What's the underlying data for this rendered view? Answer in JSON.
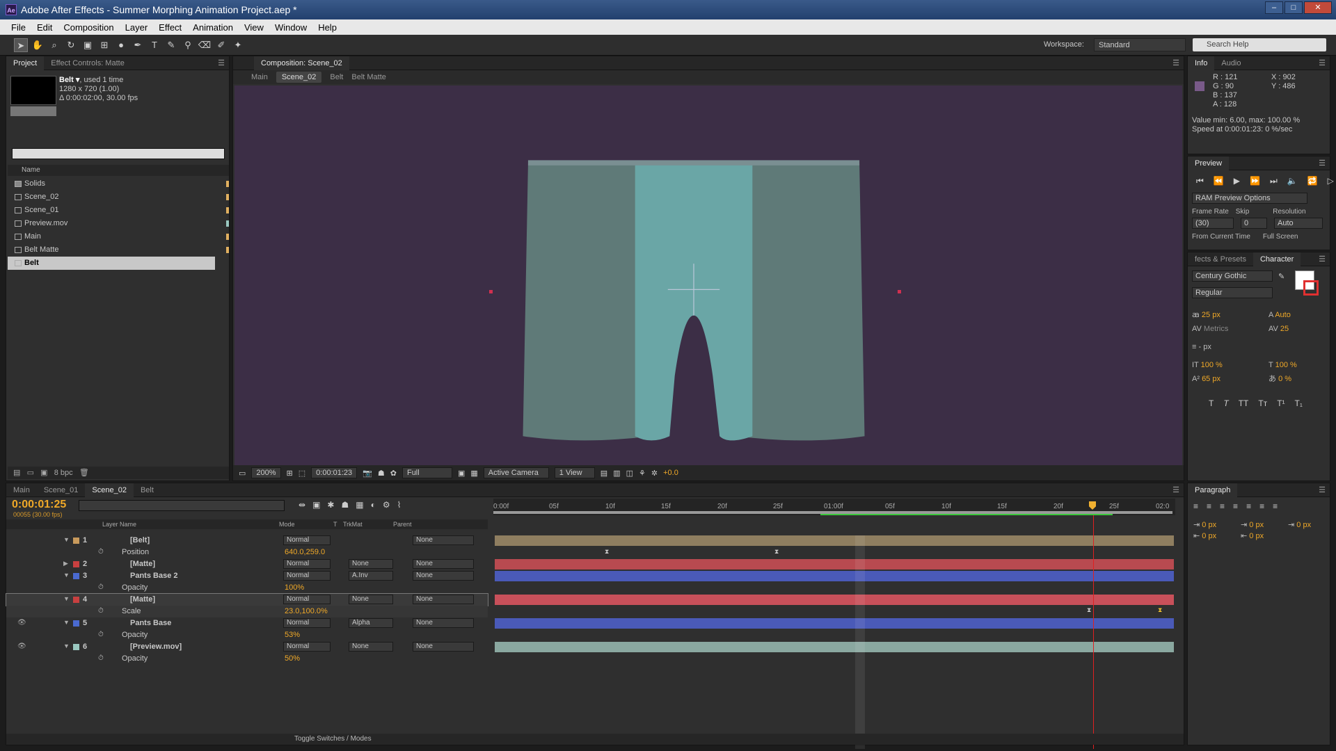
{
  "window": {
    "title": "Adobe After Effects - Summer Morphing Animation Project.aep *",
    "logo": "Ae"
  },
  "menu": [
    "File",
    "Edit",
    "Composition",
    "Layer",
    "Effect",
    "Animation",
    "View",
    "Window",
    "Help"
  ],
  "toolbar": {
    "workspace_label": "Workspace:",
    "workspace_value": "Standard",
    "search_placeholder": "Search Help"
  },
  "project": {
    "tabs": [
      "Project",
      "Effect Controls: Matte"
    ],
    "selected_name": "Belt ▾",
    "used": ", used 1 time",
    "dims": "1280 x 720 (1.00)",
    "duration": "Δ 0:00:02:00, 30.00 fps",
    "col_name": "Name",
    "items": [
      "Solids",
      "Scene_02",
      "Scene_01",
      "Preview.mov",
      "Main",
      "Belt Matte",
      "Belt"
    ],
    "bpc": "8 bpc"
  },
  "composition": {
    "tab": "Composition: Scene_02",
    "breadcrumbs": [
      "Main",
      "Scene_02",
      "Belt",
      "Belt Matte"
    ],
    "zoom": "200%",
    "timecode": "0:00:01:23",
    "resolution": "Full",
    "camera": "Active Camera",
    "views": "1 View",
    "exposure": "+0.0"
  },
  "timeline": {
    "tabs": [
      "Main",
      "Scene_01",
      "Scene_02",
      "Belt"
    ],
    "time": "0:00:01:25",
    "fps": "00055 (30.00 fps)",
    "headers": {
      "layer_name": "Layer Name",
      "mode": "Mode",
      "t": "T",
      "trkmat": "TrkMat",
      "parent": "Parent"
    },
    "ruler": [
      "0:00f",
      "05f",
      "10f",
      "15f",
      "20f",
      "25f",
      "01:00f",
      "05f",
      "10f",
      "15f",
      "20f",
      "25f",
      "02:0"
    ],
    "layers": [
      {
        "num": "1",
        "name": "[Belt]",
        "mode": "Normal",
        "trk": "",
        "parent": "None",
        "color": "#c89a5c",
        "bar": "#a08c6c"
      },
      {
        "num": "2",
        "name": "[Matte]",
        "mode": "Normal",
        "trk": "None",
        "parent": "None",
        "color": "#ffffff",
        "bar": "#b84a50"
      },
      {
        "num": "3",
        "name": "Pants Base 2",
        "mode": "Normal",
        "trk": "A.Inv",
        "parent": "None",
        "color": "#4a6ad0",
        "bar": "#4a5ab8"
      },
      {
        "num": "4",
        "name": "[Matte]",
        "mode": "Normal",
        "trk": "None",
        "parent": "None",
        "color": "#ffffff",
        "bar": "#b84a50"
      },
      {
        "num": "5",
        "name": "Pants Base",
        "mode": "Normal",
        "trk": "Alpha",
        "parent": "None",
        "color": "#4a6ad0",
        "bar": "#4a5ab8"
      },
      {
        "num": "6",
        "name": "[Preview.mov]",
        "mode": "Normal",
        "trk": "None",
        "parent": "None",
        "color": "#9ac8c0",
        "bar": "#8aa8a0"
      }
    ],
    "props": [
      {
        "name": "Position",
        "value": "640.0,259.0"
      },
      {
        "name": "Opacity",
        "value": "100%"
      },
      {
        "name": "Scale",
        "value": "23.0,100.0%"
      },
      {
        "name": "Opacity",
        "value": "53%"
      },
      {
        "name": "Opacity",
        "value": "50%"
      }
    ],
    "toggle": "Toggle Switches / Modes"
  },
  "info": {
    "tabs": [
      "Info",
      "Audio"
    ],
    "r": "R : 121",
    "g": "G : 90",
    "b": "B : 137",
    "a": "A : 128",
    "x": "X : 902",
    "y": "Y : 486",
    "value": "Value min: 6.00, max: 100.00 %",
    "speed": "Speed at 0:00:01:23: 0 %/sec",
    "swatch": "#795a89"
  },
  "preview": {
    "tab": "Preview",
    "options": "RAM Preview Options",
    "frame_rate_label": "Frame Rate",
    "skip_label": "Skip",
    "resolution_label": "Resolution",
    "frame_rate": "(30)",
    "skip": "0",
    "resolution": "Auto",
    "from_current": "From Current Time",
    "full_screen": "Full Screen"
  },
  "character": {
    "tabs": [
      "fects & Presets",
      "Character"
    ],
    "font": "Century Gothic",
    "style": "Regular",
    "size": "25 px",
    "leading": "Auto",
    "kerning": "Metrics",
    "tracking": "25",
    "stroke": "- px",
    "vscale": "100 %",
    "hscale": "100 %",
    "baseline": "65 px",
    "tsume": "0 %"
  },
  "paragraph": {
    "tab": "Paragraph",
    "v1": "0 px",
    "v2": "0 px",
    "v3": "0 px",
    "v4": "0 px",
    "v5": "0 px"
  }
}
